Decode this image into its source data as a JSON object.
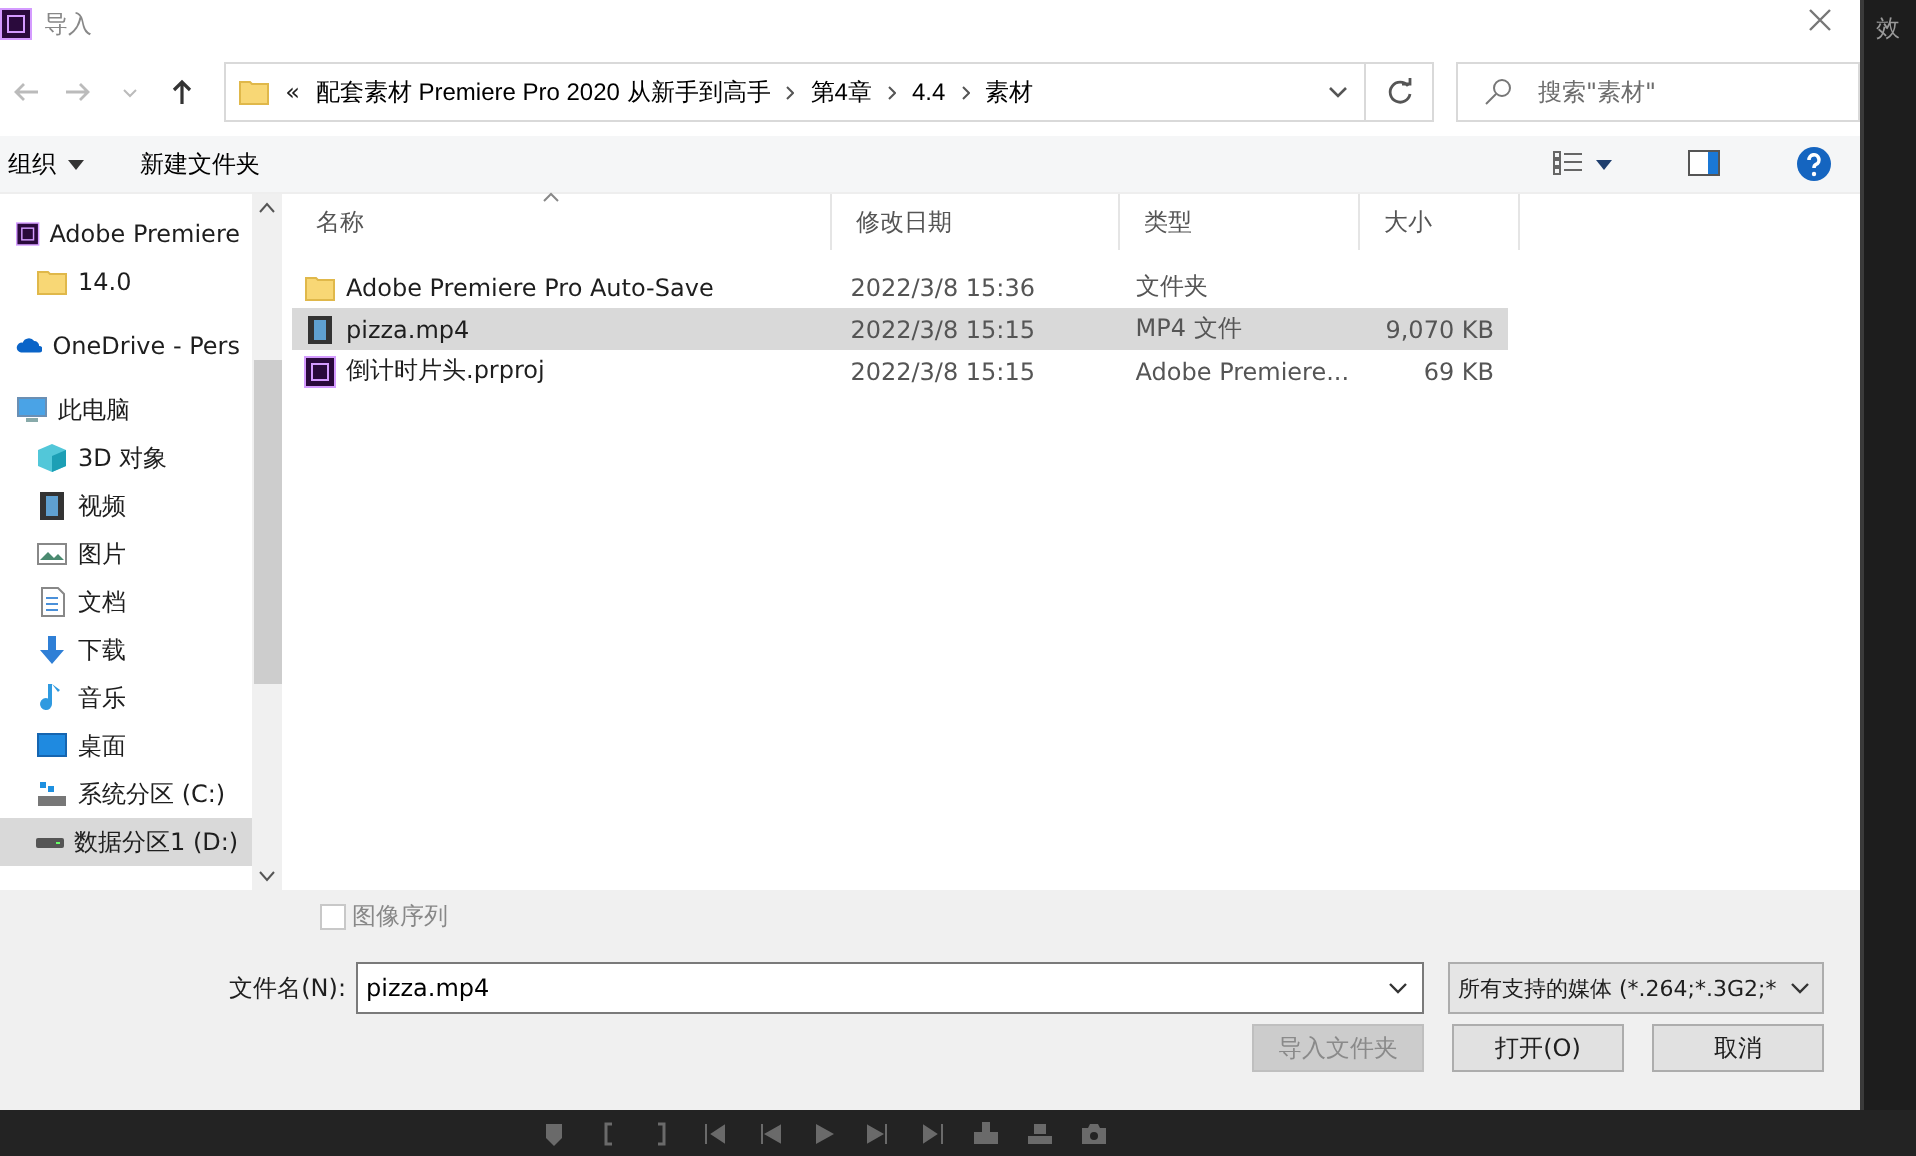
{
  "window": {
    "title": "导入"
  },
  "address": {
    "overflow": "«",
    "crumbs": [
      "配套素材 Premiere Pro 2020 从新手到高手",
      "第4章",
      "4.4",
      "素材"
    ]
  },
  "search": {
    "placeholder": "搜索\"素材\""
  },
  "toolbar": {
    "organize": "组织",
    "new_folder": "新建文件夹"
  },
  "nav": [
    {
      "label": "Adobe Premiere",
      "kind": "premiere",
      "selected": false,
      "children": [
        {
          "label": "14.0",
          "kind": "folder",
          "selected": false
        }
      ]
    },
    {
      "label": "OneDrive - Pers",
      "kind": "onedrive",
      "selected": false
    },
    {
      "label": "此电脑",
      "kind": "pc",
      "selected": false,
      "children": [
        {
          "label": "3D 对象",
          "kind": "cube",
          "selected": false
        },
        {
          "label": "视频",
          "kind": "video",
          "selected": false
        },
        {
          "label": "图片",
          "kind": "pictures",
          "selected": false
        },
        {
          "label": "文档",
          "kind": "documents",
          "selected": false
        },
        {
          "label": "下载",
          "kind": "downloads",
          "selected": false
        },
        {
          "label": "音乐",
          "kind": "music",
          "selected": false
        },
        {
          "label": "桌面",
          "kind": "desktop",
          "selected": false
        },
        {
          "label": "系统分区 (C:)",
          "kind": "sysdrive",
          "selected": false
        },
        {
          "label": "数据分区1 (D:)",
          "kind": "drive",
          "selected": true
        }
      ]
    }
  ],
  "table": {
    "columns": [
      {
        "label": "名称",
        "sorted": true
      },
      {
        "label": "修改日期",
        "sorted": false
      },
      {
        "label": "类型",
        "sorted": false
      },
      {
        "label": "大小",
        "sorted": false
      }
    ],
    "rows": [
      {
        "kind": "folder",
        "selected": false,
        "cells": [
          "Adobe Premiere Pro Auto-Save",
          "2022/3/8 15:36",
          "文件夹",
          ""
        ]
      },
      {
        "kind": "video",
        "selected": true,
        "cells": [
          "pizza.mp4",
          "2022/3/8 15:15",
          "MP4 文件",
          "9,070 KB"
        ]
      },
      {
        "kind": "premiere",
        "selected": false,
        "cells": [
          "倒计时片头.prproj",
          "2022/3/8 15:15",
          "Adobe Premiere...",
          "69 KB"
        ]
      }
    ]
  },
  "image_sequence": {
    "label": "图像序列",
    "checked": false,
    "disabled": true
  },
  "file_name": {
    "label": "文件名(N):",
    "value": "pizza.mp4"
  },
  "file_type": {
    "value": "所有支持的媒体 (*.264;*.3G2;*"
  },
  "buttons": [
    {
      "label": "导入文件夹",
      "disabled": true
    },
    {
      "label": "打开(O)",
      "disabled": false
    },
    {
      "label": "取消",
      "disabled": false
    }
  ],
  "side_panel": {
    "title": "效"
  }
}
